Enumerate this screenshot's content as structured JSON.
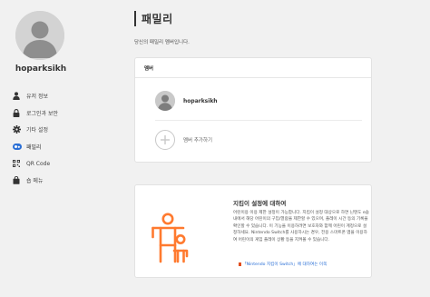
{
  "profile": {
    "username": "hoparksikh"
  },
  "nav": {
    "items": [
      {
        "label": "유저 정보",
        "icon": "person-icon"
      },
      {
        "label": "로그인과 보안",
        "icon": "lock-icon"
      },
      {
        "label": "기타 설정",
        "icon": "gear-icon"
      },
      {
        "label": "패밀리",
        "icon": "family-icon"
      },
      {
        "label": "QR Code",
        "icon": "qr-code-icon"
      },
      {
        "label": "숍 메뉴",
        "icon": "shopping-bag-icon"
      }
    ],
    "active_index": 3
  },
  "page": {
    "title": "패밀리",
    "subtitle": "당신의 패밀리 멤버입니다."
  },
  "members": {
    "header": "멤버",
    "list": [
      {
        "name": "hoparksikh"
      }
    ],
    "add_label": "멤버 추가하기"
  },
  "parental": {
    "title": "지킴이 설정에 대하여",
    "description": "어린이용 이용 제한 설정이 가능합니다. 지킴이 설정 대상으로 하면 닌텐도 e숍 내에서 해당 어린이의 구입/열람을 제한할 수 있으며, 플레이 시간 등의 기록을 확인할 수 있습니다. 이 기능을 이용하려면 보호자와 함께 어린이 계정으로 설정하세요. Nintendo Switch를 사용하시는 경우, 전용 스마트폰 앱을 이용하여 어린이의 게임 플레이 상황 등을 지켜볼 수 있습니다.",
    "link": "「Nintendo 지킴이 Switch」에 대하여는 이쪽"
  },
  "colors": {
    "accent": "#ff7a2f",
    "nav_active": "#2a6fd6",
    "link": "#2a6fd6",
    "background": "#f1f1f1"
  }
}
